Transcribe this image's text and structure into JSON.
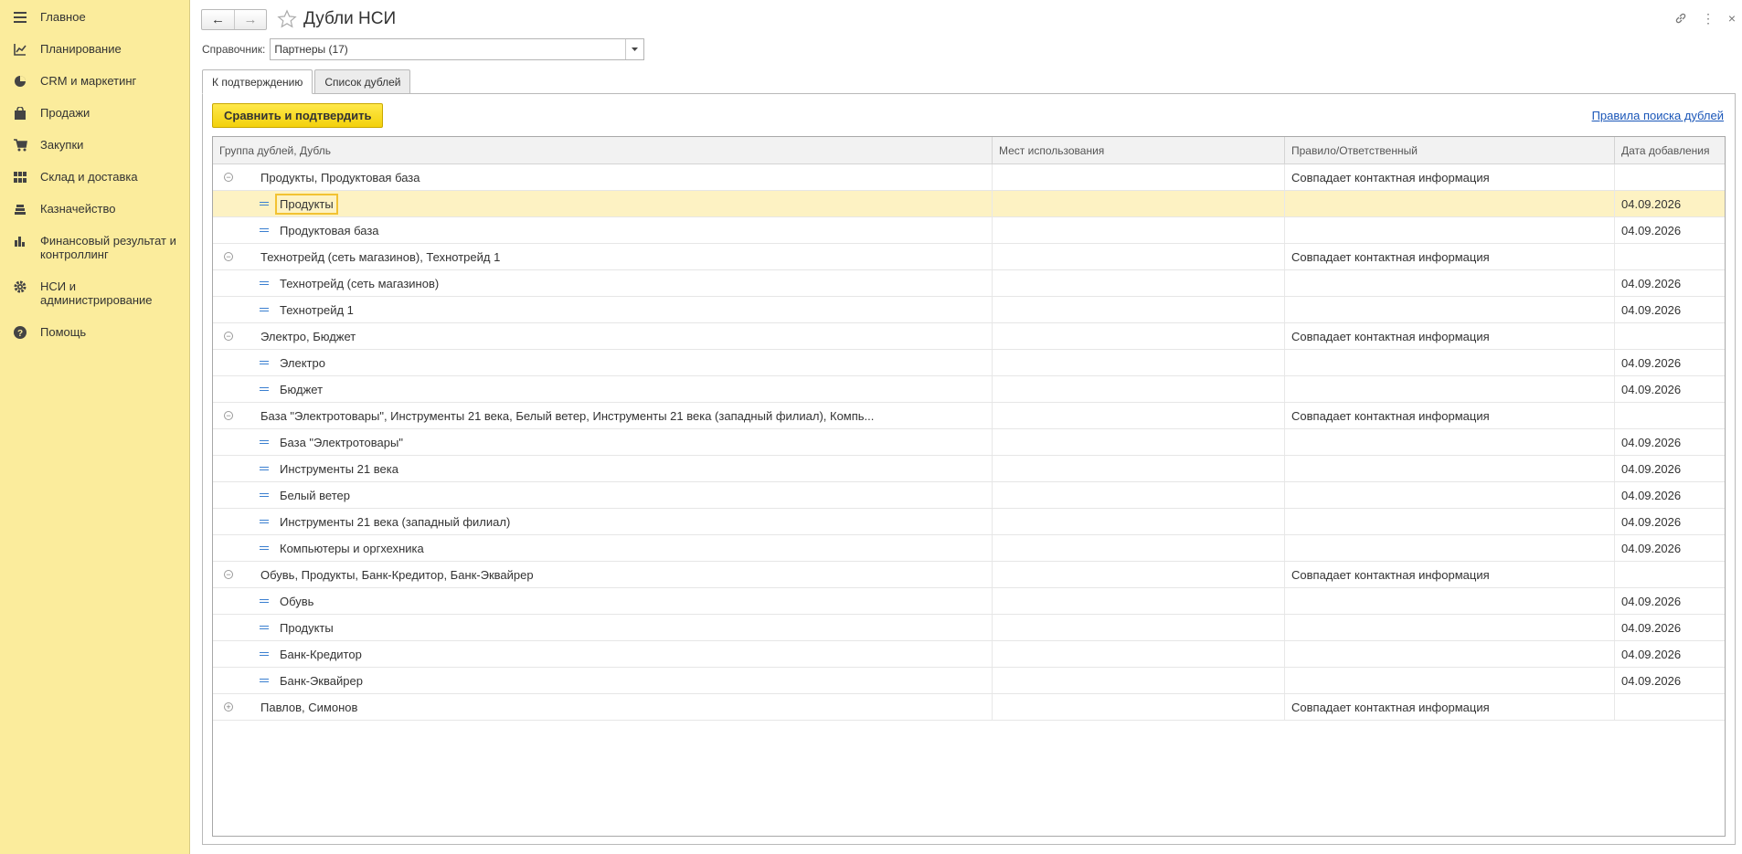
{
  "sidebar": {
    "items": [
      {
        "label": "Главное",
        "icon": "menu-icon"
      },
      {
        "label": "Планирование",
        "icon": "planning-icon"
      },
      {
        "label": "CRM и маркетинг",
        "icon": "pie-chart-icon"
      },
      {
        "label": "Продажи",
        "icon": "shopping-bag-icon"
      },
      {
        "label": "Закупки",
        "icon": "cart-icon"
      },
      {
        "label": "Склад и доставка",
        "icon": "warehouse-grid-icon"
      },
      {
        "label": "Казначейство",
        "icon": "coins-icon"
      },
      {
        "label": "Финансовый результат и контроллинг",
        "icon": "bar-chart-icon"
      },
      {
        "label": "НСИ и администрирование",
        "icon": "gear-icon"
      },
      {
        "label": "Помощь",
        "icon": "help-icon"
      }
    ]
  },
  "header": {
    "title": "Дубли НСИ"
  },
  "filter": {
    "label": "Справочник:",
    "value": "Партнеры (17)"
  },
  "tabs": [
    {
      "label": "К подтверждению",
      "active": true
    },
    {
      "label": "Список дублей",
      "active": false
    }
  ],
  "toolbar": {
    "compare_label": "Сравнить и подтвердить",
    "rules_link": "Правила поиска дублей"
  },
  "grid": {
    "columns": [
      "Группа дублей, Дубль",
      "Мест использования",
      "Правило/Ответственный",
      "Дата добавления"
    ],
    "rows": [
      {
        "type": "group",
        "name": "Продукты, Продуктовая база",
        "rule": "Совпадает контактная информация",
        "date": "",
        "expanded": true
      },
      {
        "type": "item",
        "name": "Продукты",
        "rule": "",
        "date": "04.09.2026",
        "selected": true
      },
      {
        "type": "item",
        "name": "Продуктовая база",
        "rule": "",
        "date": "04.09.2026"
      },
      {
        "type": "group",
        "name": "Технотрейд (сеть магазинов), Технотрейд 1",
        "rule": "Совпадает контактная информация",
        "date": "",
        "expanded": true
      },
      {
        "type": "item",
        "name": "Технотрейд (сеть магазинов)",
        "rule": "",
        "date": "04.09.2026"
      },
      {
        "type": "item",
        "name": "Технотрейд 1",
        "rule": "",
        "date": "04.09.2026"
      },
      {
        "type": "group",
        "name": "Электро, Бюджет",
        "rule": "Совпадает контактная информация",
        "date": "",
        "expanded": true
      },
      {
        "type": "item",
        "name": "Электро",
        "rule": "",
        "date": "04.09.2026"
      },
      {
        "type": "item",
        "name": "Бюджет",
        "rule": "",
        "date": "04.09.2026"
      },
      {
        "type": "group",
        "name": "База \"Электротовары\", Инструменты 21 века, Белый ветер, Инструменты 21 века (западный филиал), Компь...",
        "rule": "Совпадает контактная информация",
        "date": "",
        "expanded": true
      },
      {
        "type": "item",
        "name": "База \"Электротовары\"",
        "rule": "",
        "date": "04.09.2026"
      },
      {
        "type": "item",
        "name": "Инструменты 21 века",
        "rule": "",
        "date": "04.09.2026"
      },
      {
        "type": "item",
        "name": "Белый ветер",
        "rule": "",
        "date": "04.09.2026"
      },
      {
        "type": "item",
        "name": "Инструменты 21 века (западный филиал)",
        "rule": "",
        "date": "04.09.2026"
      },
      {
        "type": "item",
        "name": "Компьютеры и оргхехника",
        "rule": "",
        "date": "04.09.2026"
      },
      {
        "type": "group",
        "name": "Обувь, Продукты, Банк-Кредитор, Банк-Эквайрер",
        "rule": "Совпадает контактная информация",
        "date": "",
        "expanded": true
      },
      {
        "type": "item",
        "name": "Обувь",
        "rule": "",
        "date": "04.09.2026"
      },
      {
        "type": "item",
        "name": "Продукты",
        "rule": "",
        "date": "04.09.2026"
      },
      {
        "type": "item",
        "name": "Банк-Кредитор",
        "rule": "",
        "date": "04.09.2026"
      },
      {
        "type": "item",
        "name": "Банк-Эквайрер",
        "rule": "",
        "date": "04.09.2026"
      },
      {
        "type": "group",
        "name": "Павлов, Симонов",
        "rule": "Совпадает контактная информация",
        "date": "",
        "expanded": false
      }
    ]
  }
}
